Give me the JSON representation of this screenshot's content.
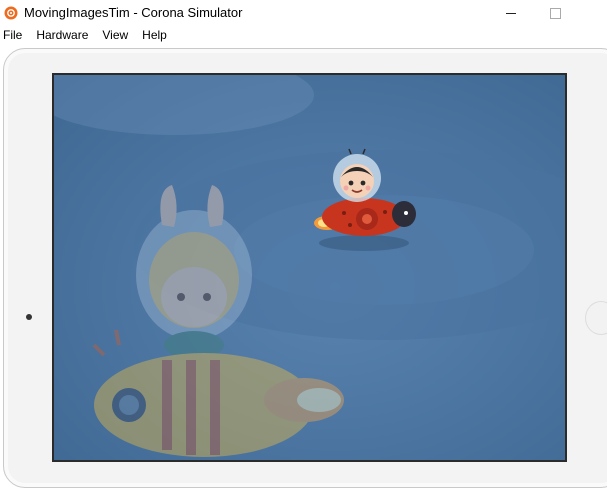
{
  "window": {
    "title": "MovingImagesTim - Corona Simulator",
    "app_icon": "corona-logo-icon",
    "minimize_icon": "minimize-icon",
    "maximize_icon": "maximize-icon"
  },
  "menu": {
    "items": [
      {
        "label": "File"
      },
      {
        "label": "Hardware"
      },
      {
        "label": "View"
      },
      {
        "label": "Help"
      }
    ]
  },
  "colors": {
    "background": "#4f79a6",
    "ship_body": "#c8351e",
    "faded_ship": "#e6d16a"
  }
}
